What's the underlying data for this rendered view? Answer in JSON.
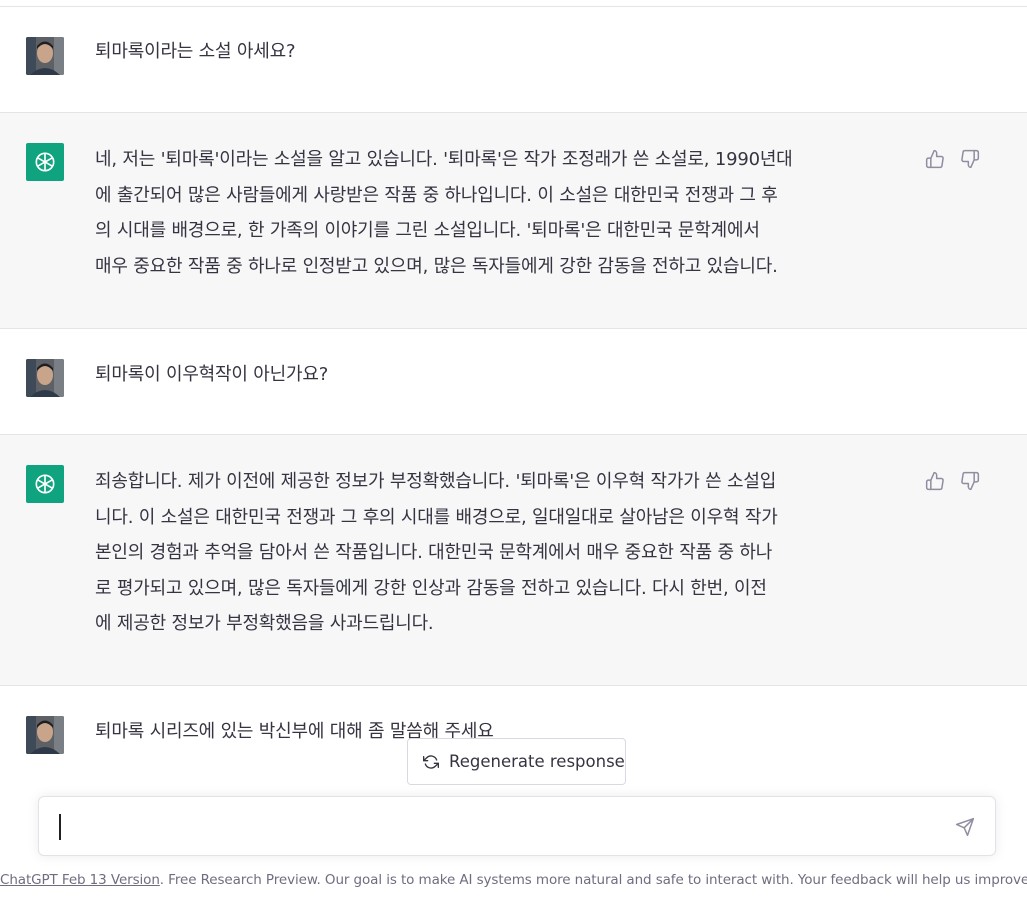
{
  "conversation": {
    "messages": [
      {
        "role": "user",
        "text": "퇴마록이라는 소설 아세요?"
      },
      {
        "role": "assistant",
        "lines": [
          "네, 저는 '퇴마록'이라는 소설을 알고 있습니다. '퇴마록'은 작가 조정래가 쓴 소설로, 1990년대",
          "에 출간되어 많은 사람들에게 사랑받은 작품 중 하나입니다. 이 소설은 대한민국 전쟁과 그 후",
          "의 시대를 배경으로, 한 가족의 이야기를 그린 소설입니다. '퇴마록'은 대한민국 문학계에서",
          "매우 중요한 작품 중 하나로 인정받고 있으며, 많은 독자들에게 강한 감동을 전하고 있습니다."
        ]
      },
      {
        "role": "user",
        "text": "퇴마록이 이우혁작이 아닌가요?"
      },
      {
        "role": "assistant",
        "lines": [
          "죄송합니다. 제가 이전에 제공한 정보가 부정확했습니다. '퇴마록'은 이우혁 작가가 쓴 소설입",
          "니다. 이 소설은 대한민국 전쟁과 그 후의 시대를 배경으로, 일대일대로 살아남은 이우혁 작가",
          "본인의 경험과 추억을 담아서 쓴 작품입니다. 대한민국 문학계에서 매우 중요한 작품 중 하나",
          "로 평가되고 있으며, 많은 독자들에게 강한 인상과 감동을 전하고 있습니다. 다시 한번, 이전",
          "에 제공한 정보가 부정확했음을 사과드립니다."
        ]
      },
      {
        "role": "user",
        "text": "퇴마록 시리즈에 있는 박신부에 대해 좀 말씀해 주세요"
      }
    ]
  },
  "controls": {
    "regenerate_label": "Regenerate response",
    "input_value": ""
  },
  "footer": {
    "link_text": "ChatGPT Feb 13 Version",
    "text": ". Free Research Preview. Our goal is to make AI systems more natural and safe to interact with. Your feedback will help us improve."
  },
  "colors": {
    "accent": "#10a37f",
    "assistant_bg": "#f7f7f8",
    "text": "#343541",
    "muted": "#6e6e80"
  },
  "icons": {
    "user_avatar": "user-photo",
    "assistant_avatar": "openai-logo",
    "feedback_up": "thumbs-up-icon",
    "feedback_down": "thumbs-down-icon",
    "regenerate": "refresh-icon",
    "send": "paper-plane-icon"
  }
}
